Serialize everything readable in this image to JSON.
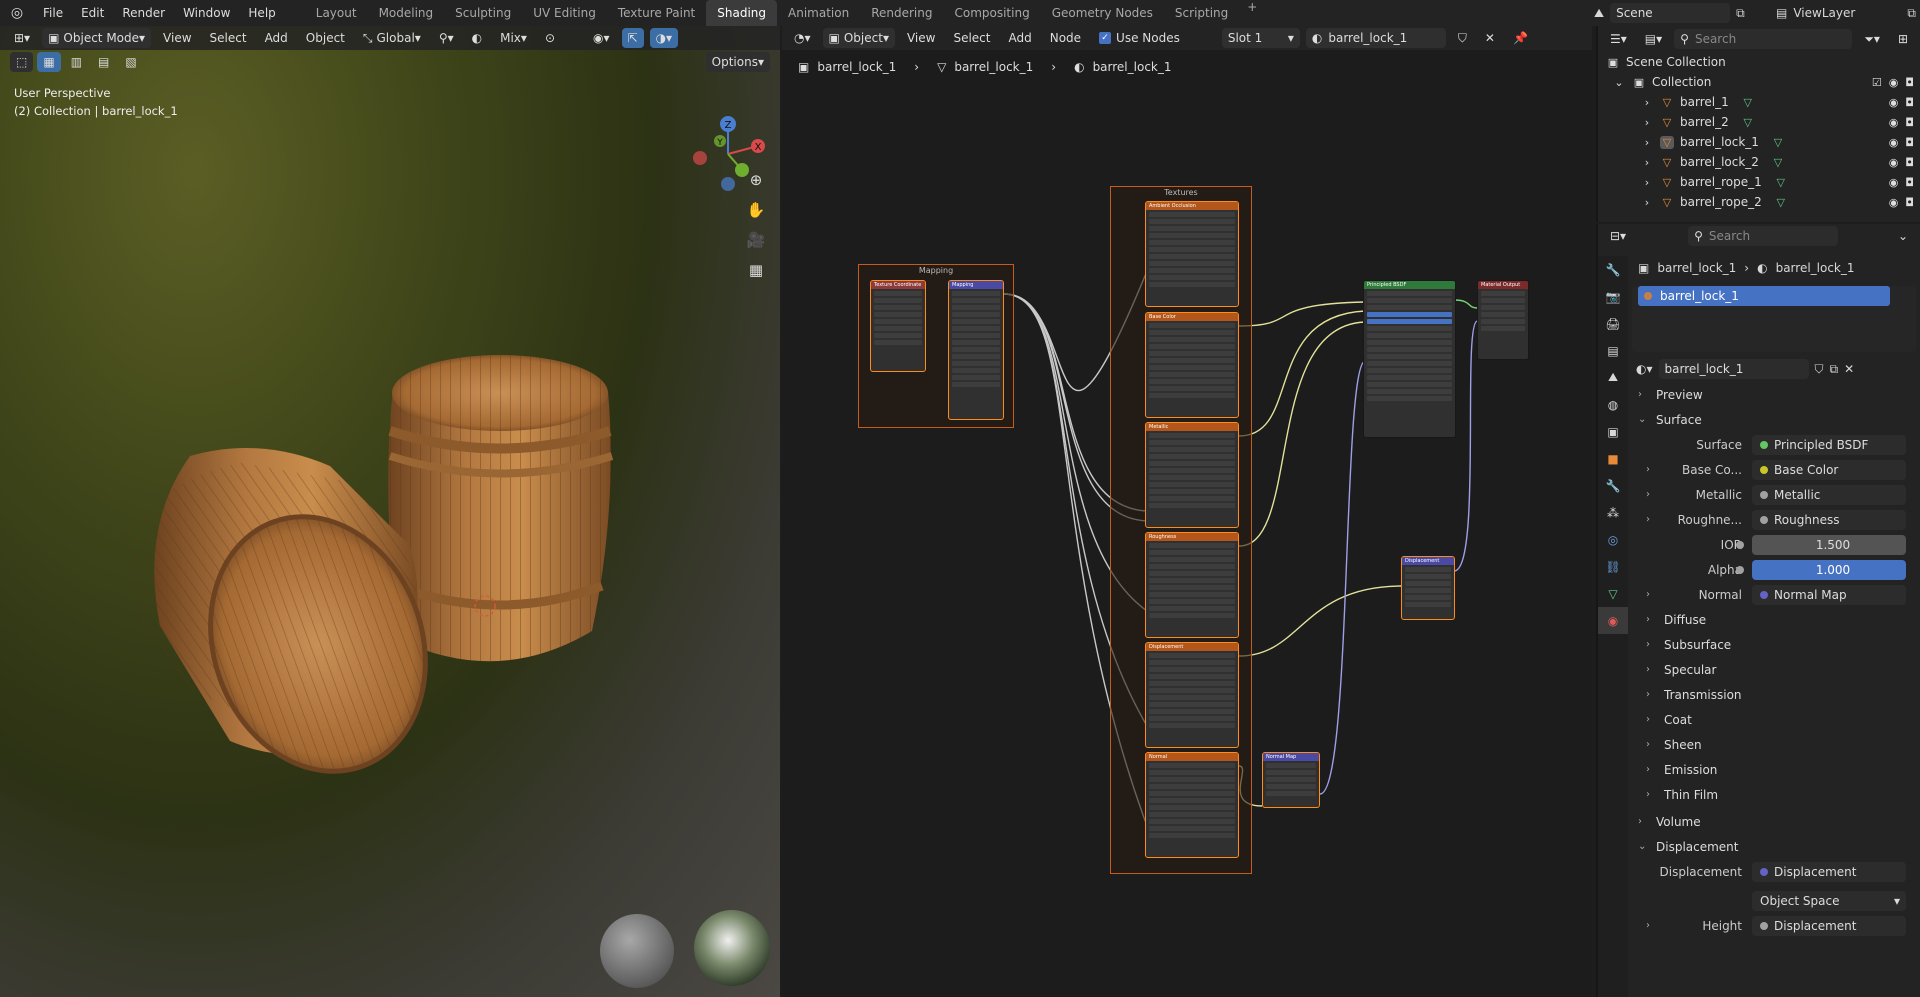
{
  "topbar": {
    "menus": [
      "File",
      "Edit",
      "Render",
      "Window",
      "Help"
    ],
    "workspaces": [
      "Layout",
      "Modeling",
      "Sculpting",
      "UV Editing",
      "Texture Paint",
      "Shading",
      "Animation",
      "Rendering",
      "Compositing",
      "Geometry Nodes",
      "Scripting"
    ],
    "active_workspace": "Shading",
    "scene": "Scene",
    "view_layer": "ViewLayer"
  },
  "viewport": {
    "mode": "Object Mode",
    "menus": [
      "View",
      "Select",
      "Add",
      "Object"
    ],
    "orientation": "Global",
    "blend": "Mix",
    "options": "Options",
    "overlay_title": "User Perspective",
    "overlay_subtitle": "(2) Collection | barrel_lock_1",
    "axes": {
      "x": "X",
      "y": "Y",
      "z": "Z"
    }
  },
  "node_editor": {
    "type": "Object",
    "menus": [
      "View",
      "Select",
      "Add",
      "Node"
    ],
    "use_nodes": "Use Nodes",
    "slot": "Slot 1",
    "material": "barrel_lock_1",
    "breadcrumb": [
      "barrel_lock_1",
      "barrel_lock_1",
      "barrel_lock_1"
    ],
    "frames": {
      "mapping": "Mapping",
      "textures": "Textures"
    },
    "nodes": {
      "tex_coord": "Texture Coordinate",
      "mapping": "Mapping",
      "ao": "Ambient Occlusion",
      "base_color": "Base Color",
      "metallic": "Metallic",
      "roughness": "Roughness",
      "displacement_tex": "Displacement",
      "normal_tex": "Normal",
      "bsdf": "Principled BSDF",
      "output": "Material Output",
      "displacement": "Displacement",
      "normal_map": "Normal Map"
    }
  },
  "outliner": {
    "search_placeholder": "Search",
    "scene_collection": "Scene Collection",
    "collection": "Collection",
    "objects": [
      "barrel_1",
      "barrel_2",
      "barrel_lock_1",
      "barrel_lock_2",
      "barrel_rope_1",
      "barrel_rope_2"
    ]
  },
  "properties": {
    "search_placeholder": "Search",
    "breadcrumb": [
      "barrel_lock_1",
      "barrel_lock_1"
    ],
    "slot_item": "barrel_lock_1",
    "material_name": "barrel_lock_1",
    "sections": {
      "preview": "Preview",
      "surface": "Surface",
      "volume": "Volume",
      "displacement": "Displacement"
    },
    "surface_rows": [
      {
        "label": "Surface",
        "value": "Principled BSDF",
        "color": "#63c763"
      },
      {
        "label": "Base Co...",
        "value": "Base Color",
        "color": "#c7c729"
      },
      {
        "label": "Metallic",
        "value": "Metallic",
        "color": "#a1a1a1"
      },
      {
        "label": "Roughne...",
        "value": "Roughness",
        "color": "#a1a1a1"
      },
      {
        "label": "IOR",
        "value": "1.500",
        "color": "#a1a1a1"
      },
      {
        "label": "Alpha",
        "value": "1.000",
        "color": "#a1a1a1"
      },
      {
        "label": "Normal",
        "value": "Normal Map",
        "color": "#6363c7"
      }
    ],
    "subpanels": [
      "Diffuse",
      "Subsurface",
      "Specular",
      "Transmission",
      "Coat",
      "Sheen",
      "Emission",
      "Thin Film"
    ],
    "disp_rows": [
      {
        "label": "Displacement",
        "value": "Displacement",
        "color": "#6363c7"
      },
      {
        "label": "",
        "value": "Object Space",
        "color": ""
      },
      {
        "label": "Height",
        "value": "Displacement",
        "color": "#a1a1a1"
      }
    ]
  },
  "icons": [
    "blender-logo",
    "search-icon",
    "eye-icon",
    "camera-icon",
    "zoom-icon",
    "hand-icon",
    "camera-view-icon",
    "grid-icon",
    "chevron-icon"
  ]
}
